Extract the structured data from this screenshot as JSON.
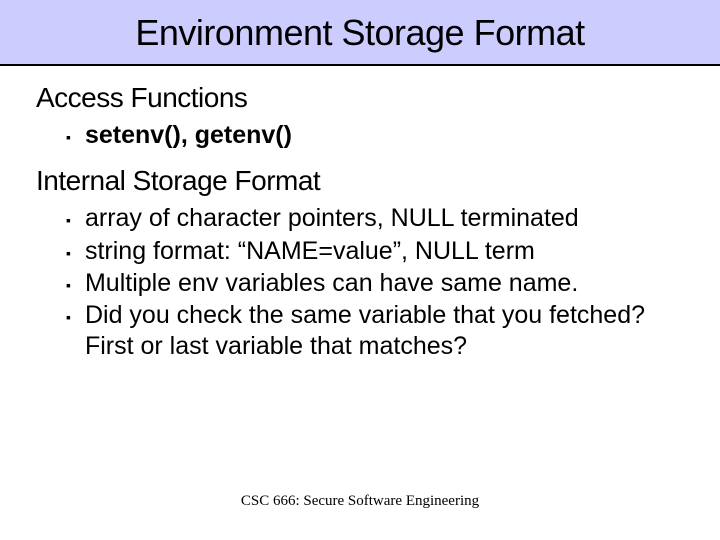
{
  "title": "Environment Storage Format",
  "sections": [
    {
      "heading": "Access Functions",
      "items": [
        {
          "text": "setenv(), getenv()",
          "bold": true
        }
      ]
    },
    {
      "heading": "Internal Storage Format",
      "items": [
        {
          "text": "array of character pointers, NULL terminated",
          "bold": false
        },
        {
          "text": "string format: “NAME=value”, NULL term",
          "bold": false
        },
        {
          "text": "Multiple env variables can have same name.",
          "bold": false
        },
        {
          "text": "Did you check the same variable that you fetched?  First or last variable that matches?",
          "bold": false
        }
      ]
    }
  ],
  "footer": "CSC 666: Secure Software Engineering",
  "bullet_char": "▪"
}
